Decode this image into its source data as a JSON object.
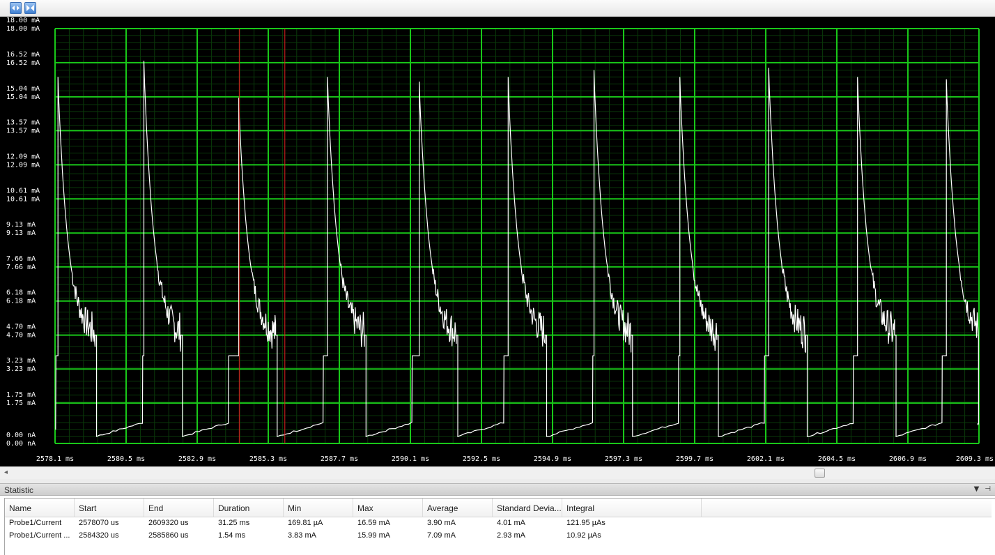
{
  "window": {
    "toolbar_icons": [
      "expand-horizontal-icon",
      "collapse-horizontal-icon"
    ]
  },
  "chart_data": {
    "type": "line",
    "y_unit": "mA",
    "ylim": [
      0.0,
      18.0
    ],
    "xlim": [
      2578.1,
      2609.3
    ],
    "y_ticks": [
      0.0,
      1.75,
      3.23,
      4.7,
      6.18,
      7.66,
      9.13,
      10.61,
      12.09,
      13.57,
      15.04,
      16.52,
      18.0
    ],
    "y_tick_labels": [
      "0.00 nA",
      "1.75 mA",
      "3.23 mA",
      "4.70 mA",
      "6.18 mA",
      "7.66 mA",
      "9.13 mA",
      "10.61 mA",
      "12.09 mA",
      "13.57 mA",
      "15.04 mA",
      "16.52 mA",
      "18.00 mA"
    ],
    "x_tick_labels": [
      "2578.1 ms",
      "2580.5 ms",
      "2582.9 ms",
      "2585.3 ms",
      "2587.7 ms",
      "2590.1 ms",
      "2592.5 ms",
      "2594.9 ms",
      "2597.3 ms",
      "2599.7 ms",
      "2602.1 ms",
      "2604.5 ms",
      "2606.9 ms",
      "2609.3 ms"
    ],
    "grid": true,
    "cursors_ms": [
      2584.32,
      2585.86
    ],
    "series": [
      {
        "pulse_starts_ms": [
          2578.2,
          2581.1,
          2584.3,
          2587.3,
          2590.4,
          2593.4,
          2596.3,
          2599.2,
          2602.2,
          2605.2,
          2608.2
        ],
        "peak_ma": [
          15.9,
          16.6,
          15.0,
          15.9,
          15.7,
          15.9,
          16.2,
          15.9,
          16.3,
          15.9,
          15.8
        ],
        "plateau_ma": [
          4.7,
          4.7,
          4.7,
          4.7,
          4.7,
          4.7,
          4.7,
          4.7,
          4.7,
          4.7,
          4.7
        ],
        "low_step_ma": [
          3.8,
          3.8,
          3.8,
          3.8,
          3.8,
          3.8,
          3.8,
          3.8,
          3.8,
          3.8,
          3.8
        ],
        "idle_ma": [
          0.3,
          0.3,
          0.3,
          0.3,
          0.3,
          0.3,
          0.3,
          0.3,
          0.3,
          0.3,
          0.3
        ]
      }
    ]
  },
  "hscroll": {
    "position_fraction": 0.84
  },
  "statistic": {
    "title": "Statistic",
    "icons": [
      "dropdown-arrow-icon",
      "pin-icon"
    ],
    "columns": [
      "Name",
      "Start",
      "End",
      "Duration",
      "Min",
      "Max",
      "Average",
      "Standard Devia...",
      "Integral"
    ],
    "rows": [
      [
        "Probe1/Current",
        "2578070 us",
        "2609320 us",
        "31.25 ms",
        "169.81 µA",
        "16.59 mA",
        "3.90 mA",
        "4.01 mA",
        "121.95 µAs"
      ],
      [
        "Probe1/Current ...",
        "2584320 us",
        "2585860 us",
        "1.54 ms",
        "3.83 mA",
        "15.99 mA",
        "7.09 mA",
        "2.93 mA",
        "10.92 µAs"
      ]
    ]
  }
}
